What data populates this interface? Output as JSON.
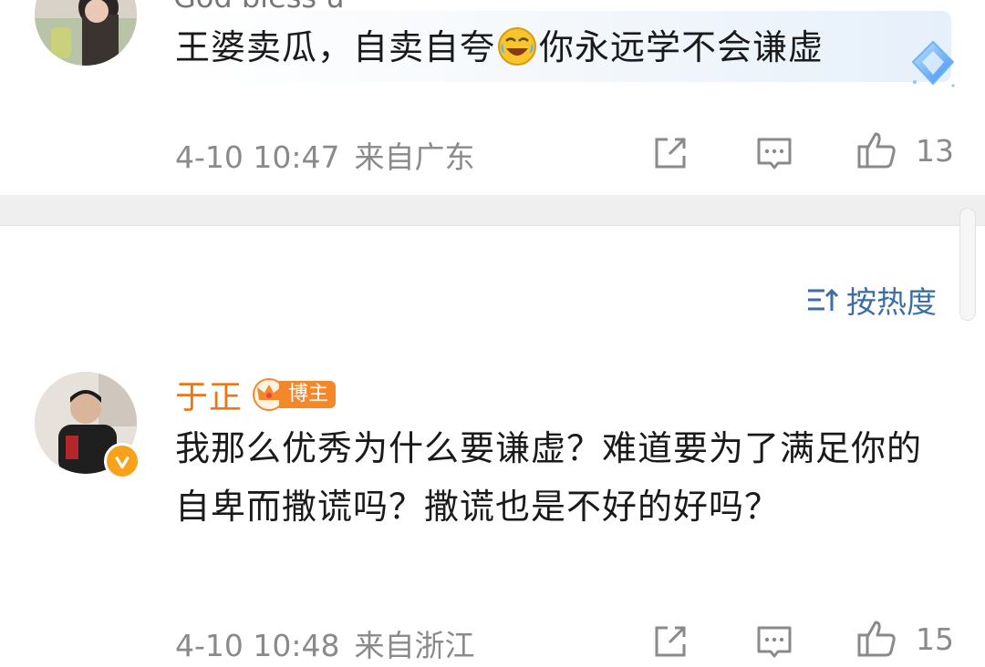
{
  "comments": [
    {
      "username_partial": "God bless u",
      "text_before_emoji": "王婆卖瓜，自卖自夸",
      "emoji": "laugh-cry-emoji",
      "text_after_emoji": "你永远学不会谦虚",
      "time": "4-10 10:47",
      "location": "来自广东",
      "likes": "13",
      "icons": {
        "share": "share-icon",
        "reply": "comment-icon",
        "like": "thumbs-up-icon",
        "badge": "diamond-badge-icon"
      }
    },
    {
      "username": "于正",
      "badge_label": "博主",
      "text": "我那么优秀为什么要谦虚？难道要为了满足你的自卑而撒谎吗？撒谎也是不好的好吗？",
      "time": "4-10 10:48",
      "location": "来自浙江",
      "likes": "15",
      "icons": {
        "share": "share-icon",
        "reply": "comment-icon",
        "like": "thumbs-up-icon",
        "verified": "verified-v-icon",
        "crown": "crown-icon"
      }
    }
  ],
  "sort": {
    "label": "按热度",
    "icon": "sort-icon"
  },
  "colors": {
    "username": "#e8761b",
    "sort": "#3a6ea5",
    "meta": "#8a8a8a",
    "badge": "#f4872a",
    "verified": "#f7a21b"
  }
}
